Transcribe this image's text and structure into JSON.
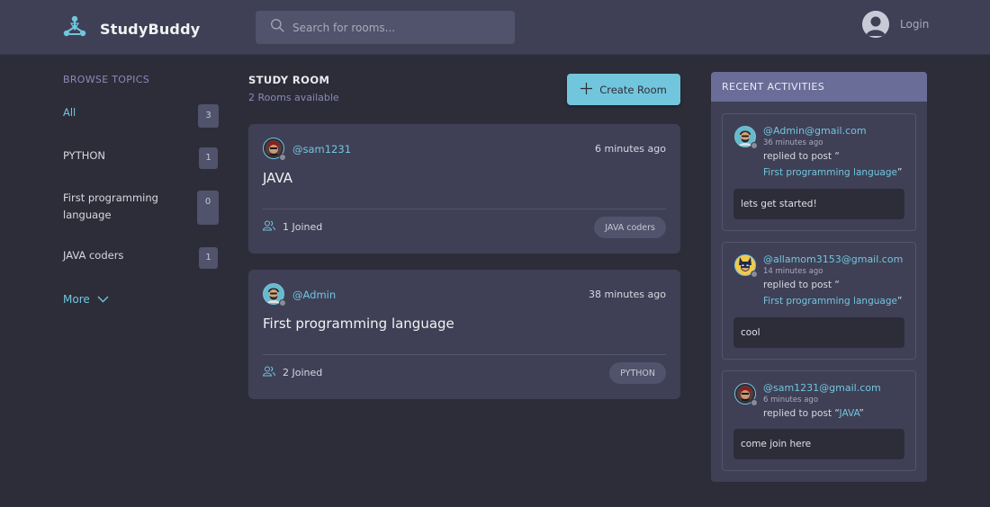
{
  "header": {
    "brand": "StudyBuddy",
    "search_placeholder": "Search for rooms...",
    "login_label": "Login"
  },
  "topics": {
    "title": "BROWSE TOPICS",
    "items": [
      {
        "label": "All",
        "count": "3"
      },
      {
        "label": "PYTHON",
        "count": "1"
      },
      {
        "label": "First programming language",
        "count": "0"
      },
      {
        "label": "JAVA coders",
        "count": "1"
      }
    ],
    "more_label": "More"
  },
  "rooms": {
    "title": "STUDY ROOM",
    "subtitle": "2 Rooms available",
    "create_label": "Create Room",
    "items": [
      {
        "host": "@sam1231",
        "time": "6 minutes ago",
        "name": "JAVA",
        "joined": "1 Joined",
        "topic": "JAVA coders"
      },
      {
        "host": "@Admin",
        "time": "38 minutes ago",
        "name": "First programming language",
        "joined": "2 Joined",
        "topic": "PYTHON"
      }
    ]
  },
  "activities": {
    "title": "RECENT ACTIVITIES",
    "items": [
      {
        "user": "@Admin@gmail.com",
        "time": "36 minutes ago",
        "reply_prefix": "replied to post “",
        "post": "First programming language",
        "quote_end": "”",
        "message": "lets get started!"
      },
      {
        "user": "@allamom3153@gmail.com",
        "time": "14 minutes ago",
        "reply_prefix": "replied to post “",
        "post": "First programming language",
        "quote_end": "”",
        "message": "cool"
      },
      {
        "user": "@sam1231@gmail.com",
        "time": "6 minutes ago",
        "reply_prefix": "replied to post “",
        "post": "JAVA",
        "quote_end": "”",
        "message": "come join here"
      }
    ]
  },
  "colors": {
    "accent": "#71c6dd",
    "background": "#2d2d39",
    "panel": "#3f4056",
    "header_bar": "#696d97"
  }
}
